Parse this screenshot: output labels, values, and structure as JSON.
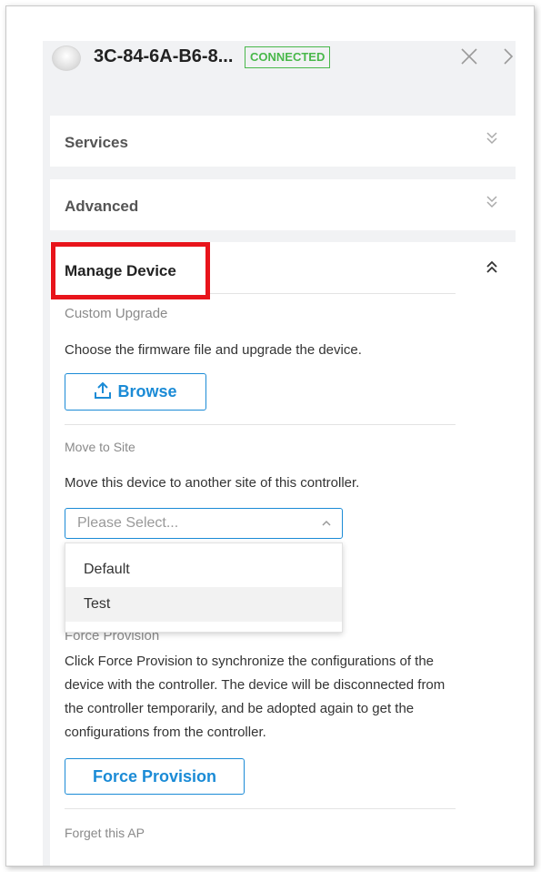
{
  "header": {
    "device_name": "3C-84-6A-B6-8...",
    "status": "CONNECTED"
  },
  "sections": {
    "services": "Services",
    "advanced": "Advanced",
    "manage_device": "Manage Device"
  },
  "custom_upgrade": {
    "label": "Custom Upgrade",
    "description": "Choose the firmware file and upgrade the device.",
    "browse_label": "Browse"
  },
  "move_to_site": {
    "label": "Move to Site",
    "description": "Move this device to another site of this controller.",
    "placeholder": "Please Select...",
    "options": [
      "Default",
      "Test"
    ]
  },
  "force_provision": {
    "label": "Force Provision",
    "description_lines": [
      "Click Force Provision to synchronize the configurations of the",
      "device with the controller. The device will be disconnected from",
      "the controller temporarily, and be adopted again to get the",
      "configurations from the controller."
    ],
    "button_label": "Force Provision"
  },
  "forget": {
    "label": "Forget this AP"
  },
  "colors": {
    "accent": "#1b8bd6",
    "connected": "#49b84b",
    "highlight": "#e8141b"
  },
  "icons": {
    "device": "access-point-icon",
    "close": "close-icon",
    "next": "chevron-right-icon",
    "collapsed": "double-chevron-down-icon",
    "expanded": "double-chevron-up-icon",
    "upload": "upload-icon"
  }
}
